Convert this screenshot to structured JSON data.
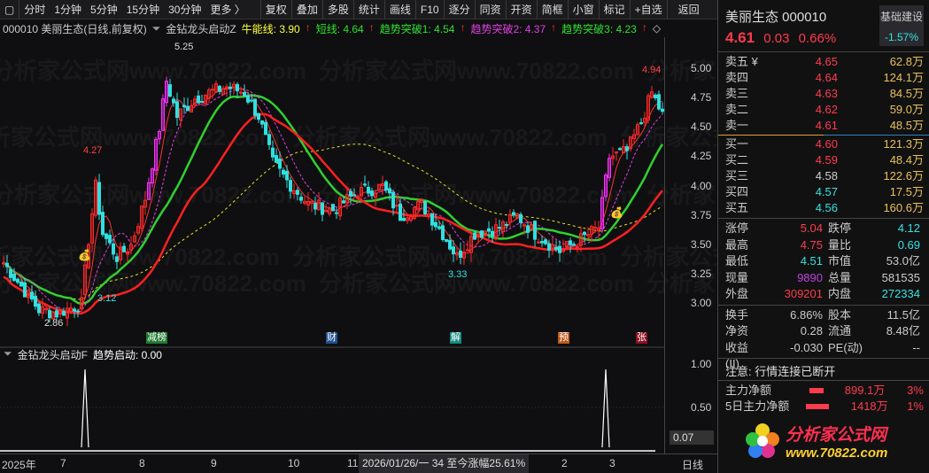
{
  "toolbar": {
    "items": [
      "分时",
      "1分钟",
      "5分钟",
      "15分钟",
      "30分钟",
      "更多 〉",
      "复权",
      "叠加",
      "多股",
      "统计",
      "画线",
      "F10",
      "逐分",
      "同资",
      "开资",
      "简框",
      "小窗",
      "标记",
      "+自选",
      "返回"
    ]
  },
  "info": {
    "title": "000010 美丽生态(日线,前复权)",
    "indicator": "金钻龙头启动Z",
    "lines": [
      {
        "label": "牛能线: 3.90",
        "color": "#ffff40"
      },
      {
        "label": "短线: 4.64",
        "color": "#30e030"
      },
      {
        "label": "趋势突破1: 4.54",
        "color": "#30e030"
      },
      {
        "label": "趋势突破2: 4.37",
        "color": "#e040e0"
      },
      {
        "label": "趋势突破3: 4.23",
        "color": "#30e030"
      }
    ]
  },
  "chart": {
    "y_ticks": [
      "5.00",
      "4.75",
      "4.50",
      "4.25",
      "4.00",
      "3.75",
      "3.50",
      "3.25",
      "3.00"
    ],
    "y_min": 2.7,
    "y_max": 5.35,
    "labels": {
      "high1": "5.25",
      "high2": "4.27",
      "low1": "2.86",
      "low2": "3.12",
      "low3": "3.33",
      "high3": "4.94"
    },
    "key_closes": [
      [
        0,
        3.35
      ],
      [
        5,
        3.15
      ],
      [
        10,
        2.95
      ],
      [
        15,
        2.92
      ],
      [
        22,
        3.0
      ],
      [
        24,
        3.55
      ],
      [
        26,
        4.0
      ],
      [
        28,
        3.6
      ],
      [
        32,
        3.4
      ],
      [
        36,
        3.5
      ],
      [
        40,
        3.9
      ],
      [
        44,
        4.5
      ],
      [
        46,
        4.9
      ],
      [
        49,
        4.6
      ],
      [
        54,
        4.75
      ],
      [
        58,
        4.8
      ],
      [
        63,
        4.85
      ],
      [
        68,
        4.8
      ],
      [
        72,
        4.6
      ],
      [
        76,
        4.2
      ],
      [
        80,
        4.05
      ],
      [
        86,
        3.85
      ],
      [
        93,
        3.8
      ],
      [
        100,
        3.95
      ],
      [
        107,
        4.0
      ],
      [
        112,
        3.75
      ],
      [
        118,
        3.85
      ],
      [
        124,
        3.6
      ],
      [
        128,
        3.4
      ],
      [
        133,
        3.6
      ],
      [
        140,
        3.65
      ],
      [
        145,
        3.75
      ],
      [
        150,
        3.6
      ],
      [
        157,
        3.45
      ],
      [
        163,
        3.55
      ],
      [
        168,
        3.65
      ],
      [
        171,
        4.25
      ],
      [
        176,
        4.3
      ],
      [
        180,
        4.55
      ],
      [
        183,
        4.8
      ],
      [
        186,
        4.61
      ]
    ],
    "markers": [
      {
        "text": "减榜",
        "color": "#1f7a2f"
      },
      {
        "text": "财",
        "color": "#1f4f8f"
      },
      {
        "text": "解",
        "color": "#118a80"
      },
      {
        "text": "预",
        "color": "#c05a1a"
      },
      {
        "text": "张",
        "color": "#8a1020"
      }
    ]
  },
  "sub": {
    "title": "金钻龙头启动F",
    "value": "趋势启动: 0.00",
    "y_ticks": [
      "1.00",
      "0.50"
    ],
    "current": "0.07",
    "spike_days": [
      23,
      170
    ]
  },
  "datebar": {
    "labels": [
      "2025年",
      "7",
      "8",
      "9",
      "10",
      "11",
      "2",
      "3"
    ],
    "highlight": "2026/01/26/一 34 至今涨幅25.61%",
    "period": "日线"
  },
  "watermark": "分析家公式网www.70822.com",
  "quote": {
    "name": "美丽生态 000010",
    "price": "4.61",
    "change": "0.03",
    "pct": "0.66%",
    "sector": "基础建设",
    "sector_pct": "-1.57%",
    "asks": [
      [
        "卖五 ¥",
        "4.65",
        "62.8万"
      ],
      [
        "卖四",
        "4.64",
        "124.1万"
      ],
      [
        "卖三",
        "4.63",
        "84.5万"
      ],
      [
        "卖二",
        "4.62",
        "59.0万"
      ],
      [
        "卖一",
        "4.61",
        "48.5万"
      ]
    ],
    "bids": [
      [
        "买一",
        "4.60",
        "121.3万"
      ],
      [
        "买二",
        "4.59",
        "48.4万"
      ],
      [
        "买三",
        "4.58",
        "122.6万"
      ],
      [
        "买四",
        "4.57",
        "17.5万"
      ],
      [
        "买五",
        "4.56",
        "160.6万"
      ]
    ],
    "stats1": [
      [
        "涨停",
        "5.04",
        "跌停",
        "4.12"
      ],
      [
        "最高",
        "4.75",
        "量比",
        "0.69"
      ],
      [
        "最低",
        "4.51",
        "市值",
        "53.0亿"
      ],
      [
        "现量",
        "9890",
        "总量",
        "581535"
      ],
      [
        "外盘",
        "309201",
        "内盘",
        "272334"
      ]
    ],
    "stats2": [
      [
        "换手",
        "6.86%",
        "股本",
        "11.5亿"
      ],
      [
        "净资",
        "0.28",
        "流通",
        "8.48亿"
      ],
      [
        "收益(II)",
        "-0.030",
        "PE(动)",
        "--"
      ]
    ],
    "notice": "注意: 行情连接已断开",
    "flows": [
      [
        "主力净额",
        "899.1万",
        "3%"
      ],
      [
        "5日主力净额",
        "1418万",
        "1%"
      ]
    ]
  },
  "logo": {
    "text": "分析家公式网",
    "url": "www.70822.com"
  }
}
